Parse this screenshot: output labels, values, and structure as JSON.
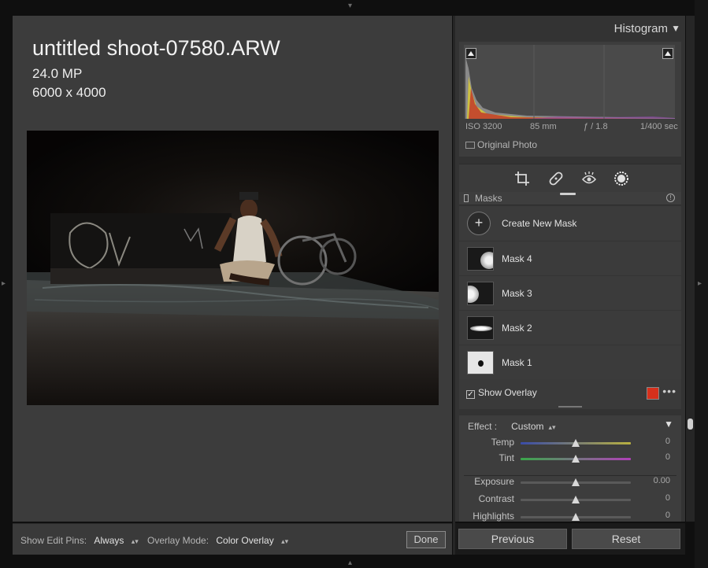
{
  "photo_info": {
    "filename": "untitled shoot-07580.ARW",
    "megapixels": "24.0 MP",
    "dimensions": "6000 x 4000"
  },
  "bottom_bar": {
    "edit_pins_label": "Show Edit Pins:",
    "edit_pins_value": "Always",
    "overlay_mode_label": "Overlay Mode:",
    "overlay_mode_value": "Color Overlay",
    "done_label": "Done"
  },
  "histogram": {
    "title": "Histogram",
    "iso": "ISO 3200",
    "focal_length": "85 mm",
    "aperture": "ƒ / 1.8",
    "shutter": "1/400 sec",
    "original_photo_label": "Original Photo"
  },
  "tools": [
    "crop-icon",
    "healing-icon",
    "red-eye-icon",
    "masking-icon"
  ],
  "masks": {
    "title": "Masks",
    "create_label": "Create New Mask",
    "items": [
      {
        "label": "Mask 4"
      },
      {
        "label": "Mask 3"
      },
      {
        "label": "Mask 2"
      },
      {
        "label": "Mask 1"
      }
    ],
    "show_overlay_label": "Show Overlay",
    "show_overlay_checked": true,
    "overlay_color": "#d6301c",
    "more_glyph": "•••"
  },
  "adjust": {
    "effect_label": "Effect :",
    "effect_value": "Custom",
    "sliders": [
      {
        "label": "Temp",
        "value": "0",
        "position": 0.5
      },
      {
        "label": "Tint",
        "value": "0",
        "position": 0.5
      },
      {
        "label": "Exposure",
        "value": "0.00",
        "position": 0.5
      },
      {
        "label": "Contrast",
        "value": "0",
        "position": 0.5
      },
      {
        "label": "Highlights",
        "value": "0",
        "position": 0.5
      }
    ]
  },
  "buttons": {
    "previous": "Previous",
    "reset": "Reset"
  },
  "colors": {
    "accent": "#d6301c",
    "panel_bg": "#333333",
    "viewer_bg": "#3c3c3c"
  }
}
